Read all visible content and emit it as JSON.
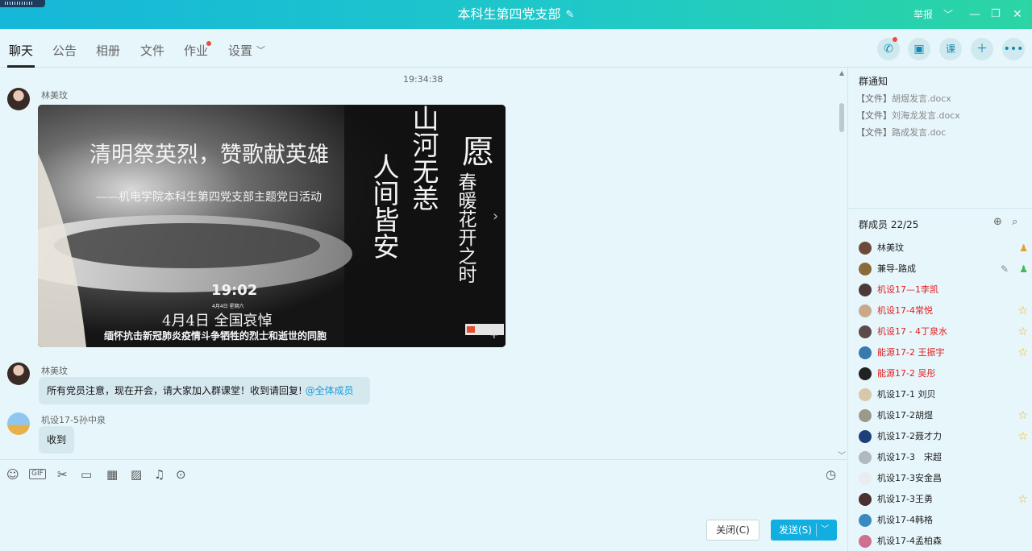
{
  "window": {
    "title": "本科生第四党支部",
    "report": "举报"
  },
  "tabs": [
    {
      "label": "聊天",
      "active": true
    },
    {
      "label": "公告"
    },
    {
      "label": "相册"
    },
    {
      "label": "文件"
    },
    {
      "label": "作业",
      "has_dot": true
    },
    {
      "label": "设置",
      "dropdown": true
    }
  ],
  "chat": {
    "timestamp": "19:34:38",
    "messages": [
      {
        "sender": "林美玟",
        "type": "image"
      },
      {
        "sender": "林美玟",
        "text": "所有党员注意，现在开会，请大家加入群课堂！收到请回复!",
        "mention": "@全体成员"
      },
      {
        "sender": "机设17-5孙中泉",
        "text": "收到"
      }
    ],
    "poster": {
      "title": "清明祭英烈，赞歌献英雄",
      "subtitle": "——机电学院本科生第四党支部主题党日活动",
      "vert1": "山河无恙",
      "vert2": "人间皆安",
      "vert3": "愿",
      "vert4": "春暖花开之时",
      "time": "19:02",
      "small_date": "4月4日 星期六",
      "mourning": "4月4日  全国哀悼",
      "caption": "缅怀抗击新冠肺炎疫情斗争牺牲的烈士和逝世的同胞"
    }
  },
  "input": {
    "close_label": "关闭(C)",
    "send_label": "发送(S)"
  },
  "notice": {
    "title": "群通知",
    "items": [
      {
        "tag": "【文件】",
        "name": "胡煜发言.docx"
      },
      {
        "tag": "【文件】",
        "name": "刘海龙发言.docx"
      },
      {
        "tag": "【文件】",
        "name": "路成发言.doc"
      }
    ]
  },
  "members": {
    "title": "群成员 22/25",
    "list": [
      {
        "name": "林美玟",
        "role": "owner"
      },
      {
        "name": "兼导-路成",
        "role": "admin"
      },
      {
        "name": "机设17—1李凯",
        "red": true
      },
      {
        "name": "机设17-4常悦",
        "red": true,
        "star": true
      },
      {
        "name": "机设17 - 4丁泉水",
        "red": true,
        "star": true
      },
      {
        "name": "能源17-2 王振宇",
        "red": true,
        "star": true
      },
      {
        "name": "能源17-2 吴彤",
        "red": true
      },
      {
        "name": "机设17-1 刘贝"
      },
      {
        "name": "机设17-2胡煜",
        "star": true
      },
      {
        "name": "机设17-2聂才力",
        "star": true
      },
      {
        "name": "机设17-3　宋超"
      },
      {
        "name": "机设17-3安金昌"
      },
      {
        "name": "机设17-3王勇",
        "star": true
      },
      {
        "name": "机设17-4韩格"
      },
      {
        "name": "机设17-4孟柏森"
      }
    ]
  },
  "colors": {
    "accent": "#12aee0",
    "red_name": "#e02020",
    "star": "#f3b400"
  }
}
